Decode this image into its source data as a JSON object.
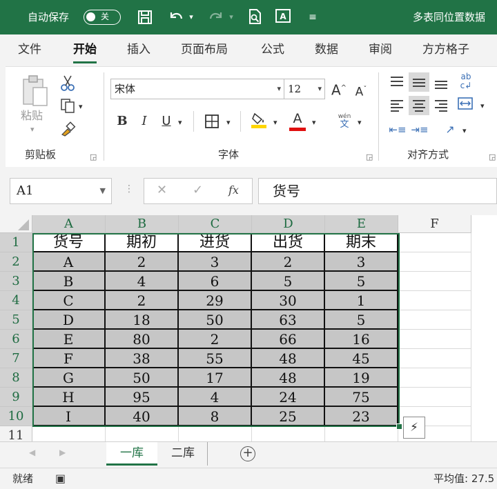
{
  "titlebar": {
    "autosave_label": "自动保存",
    "autosave_state": "关",
    "doc_title": "多表同位置数据",
    "icons": [
      "save-icon",
      "undo-icon",
      "redo-icon",
      "print-preview-icon",
      "format-painter-icon",
      "customize-qat-icon"
    ]
  },
  "tabs": [
    "文件",
    "开始",
    "插入",
    "页面布局",
    "公式",
    "数据",
    "审阅",
    "方方格子"
  ],
  "active_tab": "开始",
  "ribbon": {
    "clipboard": {
      "paste_label": "粘贴",
      "group_label": "剪贴板"
    },
    "font": {
      "font_name": "宋体",
      "font_size": "12",
      "bold": "B",
      "italic": "I",
      "underline": "U",
      "font_color_glyph": "A",
      "phonetic_top": "wén",
      "phonetic_bottom": "文",
      "grow_glyph": "A",
      "shrink_glyph": "A",
      "group_label": "字体"
    },
    "alignment": {
      "group_label": "对齐方式"
    },
    "colors": {
      "highlight": "#ffd600",
      "font_color": "#e01010",
      "accent": "#217346"
    }
  },
  "formula_bar": {
    "name_box": "A1",
    "cancel": "✕",
    "enter": "✓",
    "fx": "fx",
    "formula": "货号"
  },
  "grid": {
    "columns": [
      "A",
      "B",
      "C",
      "D",
      "E",
      "F"
    ],
    "rows": [
      "1",
      "2",
      "3",
      "4",
      "5",
      "6",
      "7",
      "8",
      "9",
      "10",
      "11"
    ],
    "header": [
      "货号",
      "期初",
      "进货",
      "出货",
      "期末"
    ],
    "data": [
      [
        "A",
        "2",
        "3",
        "2",
        "3"
      ],
      [
        "B",
        "4",
        "6",
        "5",
        "5"
      ],
      [
        "C",
        "2",
        "29",
        "30",
        "1"
      ],
      [
        "D",
        "18",
        "50",
        "63",
        "5"
      ],
      [
        "E",
        "80",
        "2",
        "66",
        "16"
      ],
      [
        "F",
        "38",
        "55",
        "48",
        "45"
      ],
      [
        "G",
        "50",
        "17",
        "48",
        "19"
      ],
      [
        "H",
        "95",
        "4",
        "24",
        "75"
      ],
      [
        "I",
        "40",
        "8",
        "25",
        "23"
      ]
    ]
  },
  "sheets": [
    "一库",
    "二库"
  ],
  "active_sheet": "一库",
  "status": {
    "ready": "就绪",
    "average": "平均值: 27.5"
  }
}
